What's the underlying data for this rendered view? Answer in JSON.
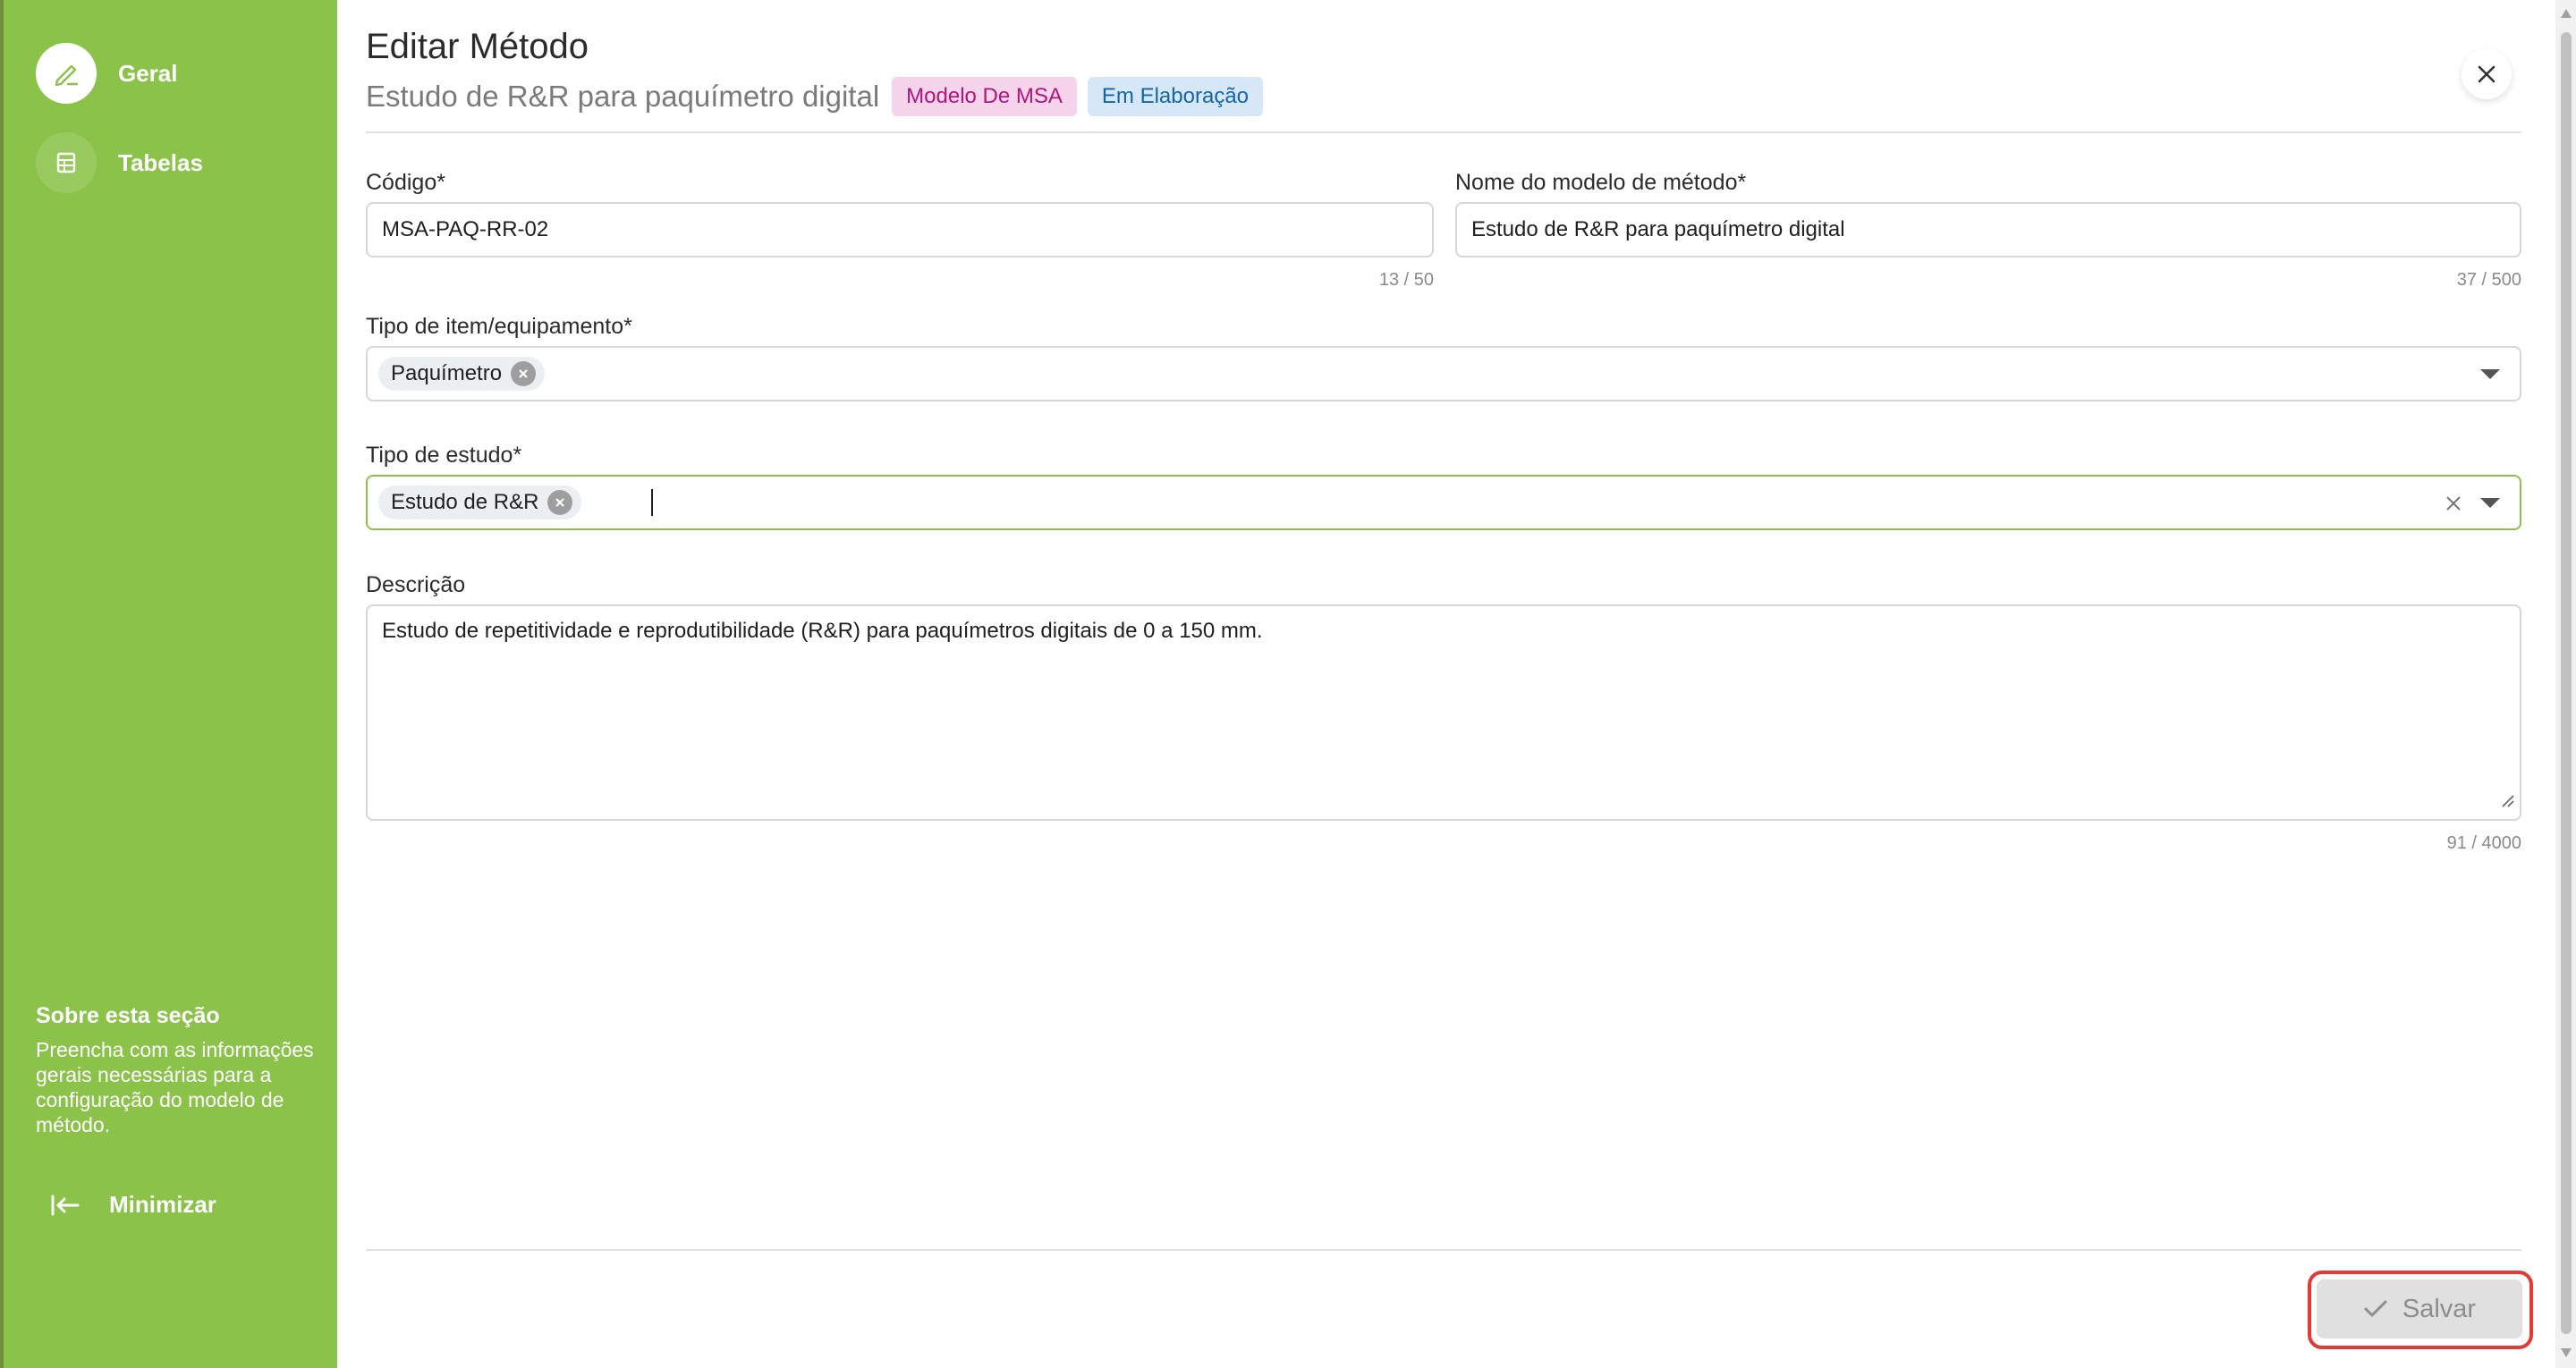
{
  "sidebar": {
    "items": [
      {
        "label": "Geral",
        "icon": "pencil-icon",
        "active": true
      },
      {
        "label": "Tabelas",
        "icon": "table-icon",
        "active": false
      }
    ],
    "about_title": "Sobre esta seção",
    "about_text": "Preencha com as informações gerais necessárias para a configuração do modelo de método.",
    "minimize_label": "Minimizar"
  },
  "header": {
    "title": "Editar Método",
    "subtitle": "Estudo de R&R para paquímetro digital",
    "badges": [
      {
        "label": "Modelo De MSA",
        "color": "#b0157a"
      },
      {
        "label": "Em Elaboração",
        "color": "#1565a8"
      }
    ]
  },
  "form": {
    "codigo": {
      "label": "Código*",
      "value": "MSA-PAQ-RR-02",
      "counter": "13 / 50"
    },
    "nome": {
      "label": "Nome do modelo de método*",
      "value": "Estudo de R&R para paquímetro digital",
      "counter": "37 / 500"
    },
    "tipo_item": {
      "label": "Tipo de item/equipamento*",
      "tag": "Paquímetro"
    },
    "tipo_estudo": {
      "label": "Tipo de estudo*",
      "tag": "Estudo de R&R"
    },
    "descricao": {
      "label": "Descrição",
      "value": "Estudo de repetitividade e reprodutibilidade (R&R) para paquímetros digitais de 0 a 150 mm.",
      "counter": "91 / 4000"
    }
  },
  "footer": {
    "save_label": "Salvar"
  },
  "colors": {
    "accent": "#8bc34a",
    "highlight": "#e53935"
  }
}
